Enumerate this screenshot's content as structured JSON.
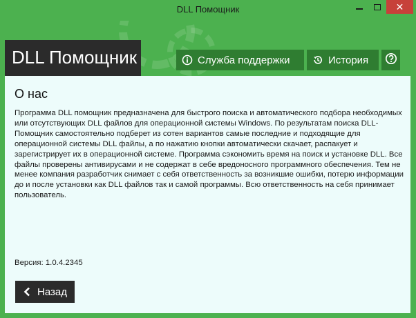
{
  "window": {
    "title": "DLL Помощник",
    "close_glyph": "✕"
  },
  "header": {
    "logo": "DLL Помощник",
    "nav": {
      "support_label": "Служба поддержки",
      "support_icon": "info-circle-icon",
      "history_label": "История",
      "history_icon": "history-icon",
      "help_icon": "help-icon"
    }
  },
  "content": {
    "title": "О нас",
    "text": "Программа DLL помощник предназначена для быстрого поиска и автоматического подбора необходимых или отсутствующих DLL файлов для операционной системы Windows. По результатам поиска DLL-Помощник самостоятельно подберет из сотен вариантов самые последние и подходящие для операционной системы DLL файлы, а по нажатию кнопки автоматически скачает, распакует и зарегистрирует их в операционной системе. Программа сэкономить время на поиск и установке DLL. Все файлы проверены антивирусами и не содержат в себе вредоносного программного обеспечения. Тем не менее компания разработчик снимает с себя ответственность за возникшие ошибки, потерю информации до и после установки как DLL файлов так и самой программы. Всю ответственность на себя принимает пользователь.",
    "version_label": "Версия:",
    "version_value": "1.0.4.2345",
    "back_label": "Назад"
  },
  "colors": {
    "window_green": "#4cb14f",
    "nav_green": "#2f7d31",
    "dark": "#2b2b2b",
    "content_bg": "#edfcfb",
    "close_red": "#c7413a"
  }
}
